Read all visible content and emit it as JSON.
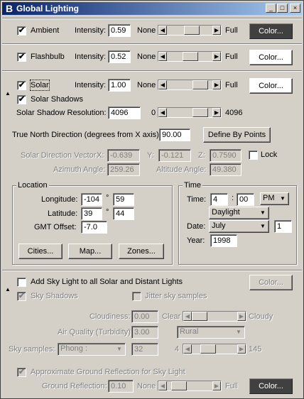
{
  "window": {
    "title": "Global Lighting",
    "app_icon_glyph": "B",
    "minimize": "_",
    "maximize": "□",
    "close": "×"
  },
  "ambient": {
    "label": "Ambient",
    "checked": "✔",
    "intensity_label": "Intensity:",
    "intensity": "0.59",
    "none": "None",
    "full": "Full",
    "color_button": "Color...",
    "level": 0.59
  },
  "flashbulb": {
    "label": "Flashbulb",
    "checked": "✔",
    "intensity_label": "Intensity:",
    "intensity": "0.52",
    "none": "None",
    "full": "Full",
    "color_button": "Color...",
    "level": 0.52
  },
  "solar": {
    "label": "Solar",
    "checked": "✔",
    "intensity_label": "Intensity:",
    "intensity": "1.00",
    "none": "None",
    "full": "Full",
    "color_button": "Color...",
    "level": 1.0,
    "shadows_label": "Solar Shadows",
    "shadows_checked": "✔",
    "resolution_label": "Solar Shadow Resolution:",
    "resolution": "4096",
    "res_min": "0",
    "res_max": "4096",
    "res_level": 1.0,
    "true_north_label": "True North Direction (degrees from X axis):",
    "true_north": "90.00",
    "define_by_points": "Define By Points",
    "vector_label": "Solar Direction Vector",
    "x_label": "X:",
    "x": "-0.639",
    "y_label": "Y:",
    "y": "-0.121",
    "z_label": "Z:",
    "z": "0.7590",
    "lock_label": "Lock",
    "azimuth_label": "Azimuth Angle:",
    "azimuth": "259.26",
    "altitude_label": "Altitude Angle:",
    "altitude": "49.380"
  },
  "location": {
    "group_label": "Location",
    "longitude_label": "Longitude:",
    "longitude_deg": "-104",
    "longitude_min": "59",
    "latitude_label": "Latitude:",
    "latitude_deg": "39",
    "latitude_min": "44",
    "degree_symbol": "°",
    "gmt_label": "GMT Offset:",
    "gmt": "-7.0",
    "cities_button": "Cities...",
    "map_button": "Map...",
    "zones_button": "Zones..."
  },
  "time": {
    "group_label": "Time",
    "time_label": "Time:",
    "hour": "4",
    "separator": ":",
    "minute": "00",
    "ampm": "PM",
    "dst": "Daylight",
    "date_label": "Date:",
    "month": "July",
    "day": "1",
    "year_label": "Year:",
    "year": "1998"
  },
  "sky": {
    "add_label": "Add Sky Light to all Solar and Distant Lights",
    "color_button": "Color...",
    "shadows_label": "Sky Shadows",
    "shadows_checked": "✔",
    "jitter_label": "Jitter sky samples",
    "cloudiness_label": "Cloudiness:",
    "cloudiness": "0.00",
    "clear": "Clear",
    "cloudy": "Cloudy",
    "air_label": "Air Quality (Turbidity)",
    "air": "3.00",
    "air_preset": "Rural",
    "samples_label": "Sky samples:",
    "samples_preset": "Phong :",
    "samples": "32",
    "samples_min": "4",
    "samples_max": "145",
    "ground_reflection_toggle_label": "Approximate Ground Reflection for Sky Light",
    "ground_checked": "✔",
    "ground_label": "Ground Reflection:",
    "ground": "0.10",
    "none": "None",
    "full": "Full",
    "ground_color_button": "Color..."
  },
  "icons": {
    "left_arrow": "◀",
    "right_arrow": "▶",
    "dropdown_arrow": "▼",
    "collapse_triangle": "▲"
  },
  "colors": {
    "title_start": "#0a246a",
    "title_end": "#a6caf0",
    "face": "#d4d0c8"
  }
}
